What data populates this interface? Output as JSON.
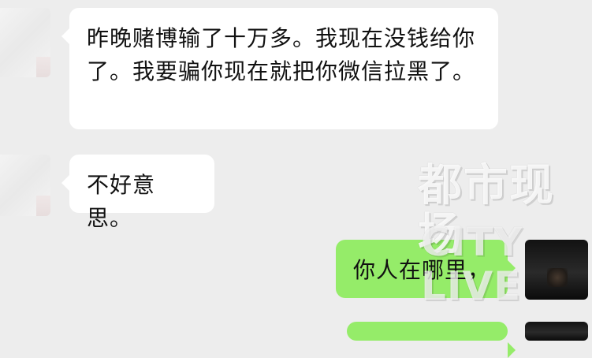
{
  "messages": [
    {
      "side": "left",
      "text": "昨晚赌博输了十万多。我现在没钱给你了。我要骗你现在就把你微信拉黑了。"
    },
    {
      "side": "left",
      "text": "不好意思。"
    },
    {
      "side": "right",
      "text": "你人在哪里，"
    },
    {
      "side": "right",
      "text": ""
    }
  ],
  "watermark": {
    "top": "都市现场",
    "bottom": "CITY LIVE"
  },
  "colors": {
    "background": "#ededed",
    "left_bubble": "#ffffff",
    "right_bubble": "#95ec69",
    "text": "#111111"
  }
}
